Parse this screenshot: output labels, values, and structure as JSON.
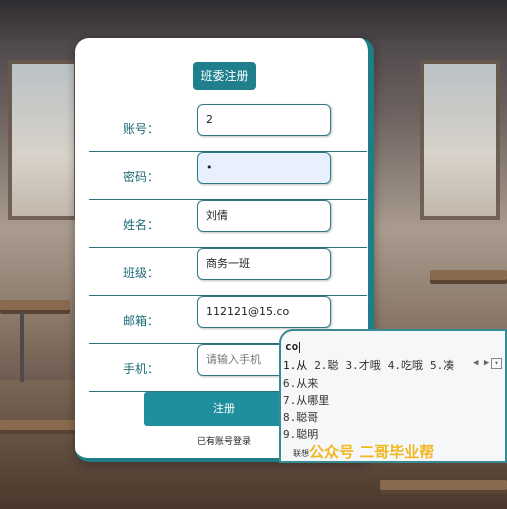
{
  "form": {
    "title": "班委注册",
    "fields": [
      {
        "label": "账号：",
        "value": "2",
        "placeholder": ""
      },
      {
        "label": "密码：",
        "value": "•",
        "placeholder": ""
      },
      {
        "label": "姓名：",
        "value": "刘倩",
        "placeholder": ""
      },
      {
        "label": "班级：",
        "value": "商务一班",
        "placeholder": ""
      },
      {
        "label": "邮箱：",
        "value": "112121@15.co",
        "placeholder": ""
      },
      {
        "label": "手机：",
        "value": "",
        "placeholder": "请输入手机"
      }
    ],
    "submit_label": "注册",
    "login_link": "已有账号登录"
  },
  "ime": {
    "pinyin": "co",
    "candidates_row": [
      "1.从",
      "2.聪",
      "3.才哦",
      "4.吃哦",
      "5.凑"
    ],
    "candidates_list": [
      "6.从来",
      "7.从哪里",
      "8.聪哥",
      "9.聪明"
    ],
    "footer": "联想",
    "nav": "◀ ▶",
    "menu_icon": "▾"
  },
  "watermark": "公众号 二哥毕业帮"
}
